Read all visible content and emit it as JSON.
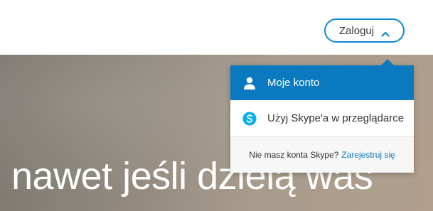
{
  "header": {
    "login_label": "Zaloguj"
  },
  "hero": {
    "text": "nawet jeśli dzielą was"
  },
  "dropdown": {
    "items": [
      {
        "label": "Moje konto",
        "icon": "user-icon"
      },
      {
        "label": "Użyj Skype'a w przeglądarce",
        "icon": "skype-icon"
      }
    ],
    "footer_text": "Nie masz konta Skype?",
    "footer_link": "Zarejestruj się"
  },
  "colors": {
    "accent": "#0a79bf",
    "button_border": "#0a8bd1",
    "skype_blue": "#00aff0"
  }
}
